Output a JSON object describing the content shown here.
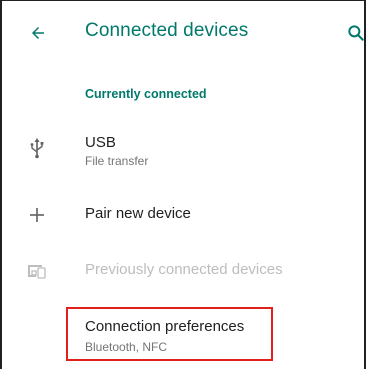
{
  "header": {
    "title": "Connected devices",
    "back_icon": "arrow-back-icon",
    "search_icon": "search-icon"
  },
  "sections": {
    "currently_connected": "Currently connected"
  },
  "items": {
    "usb": {
      "title": "USB",
      "subtitle": "File transfer",
      "icon": "usb-icon"
    },
    "pair": {
      "title": "Pair new device",
      "icon": "plus-icon"
    },
    "previous": {
      "title": "Previously connected devices",
      "icon": "devices-icon",
      "disabled": true
    },
    "preferences": {
      "title": "Connection preferences",
      "subtitle": "Bluetooth, NFC"
    }
  },
  "colors": {
    "accent": "#00796b",
    "text_primary": "#202124",
    "text_secondary": "#757575",
    "disabled": "#bdbdbd",
    "highlight": "#e0201b"
  }
}
